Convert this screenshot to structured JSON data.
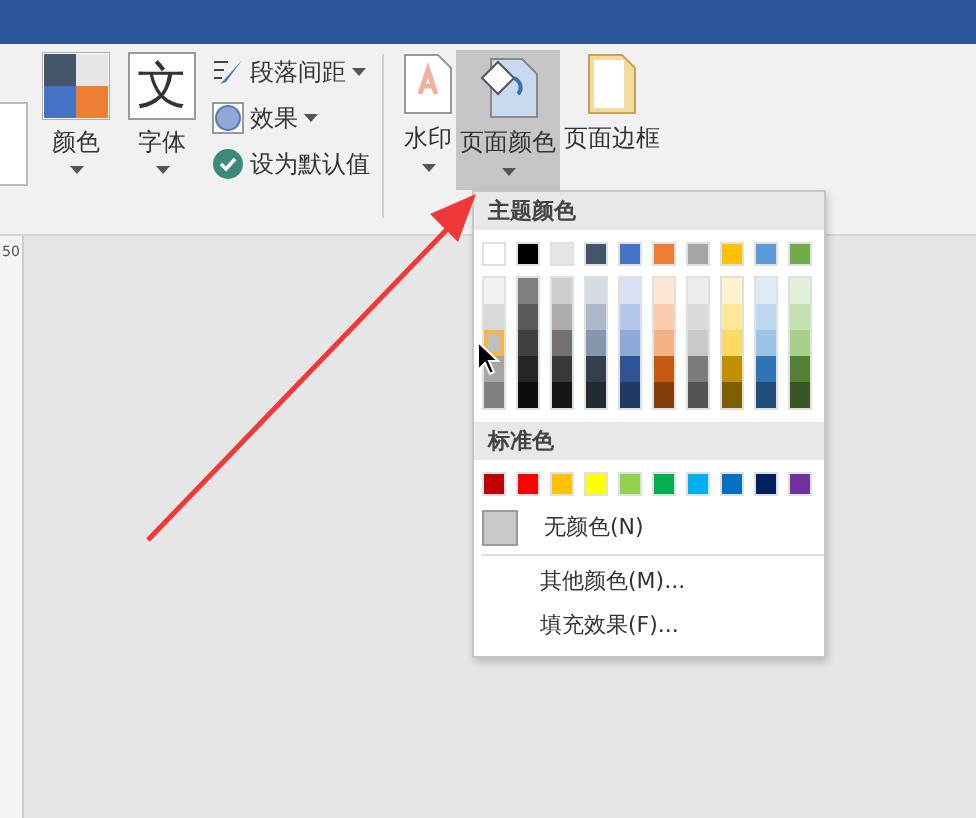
{
  "ribbon": {
    "large_left": [
      {
        "kind": "colors",
        "label": "颜色"
      },
      {
        "kind": "fonts",
        "glyph": "文",
        "label": "字体"
      }
    ],
    "small": [
      {
        "kind": "spacing",
        "label": "段落间距",
        "dropdown": true
      },
      {
        "kind": "effects",
        "label": "效果",
        "dropdown": true
      },
      {
        "kind": "default",
        "label": "设为默认值",
        "dropdown": false
      }
    ],
    "large_right": [
      {
        "kind": "watermark",
        "label": "水印",
        "dropdown": true,
        "selected": false
      },
      {
        "kind": "pagecolor",
        "label": "页面颜色",
        "dropdown": true,
        "selected": true
      },
      {
        "kind": "border",
        "label": "页面边框",
        "dropdown": false,
        "selected": false
      }
    ]
  },
  "ruler": {
    "mark": "50"
  },
  "color_menu": {
    "theme_heading": "主题颜色",
    "theme_colors": [
      {
        "color": "#ffffff",
        "selected": false,
        "shades": [
          {
            "color": "#f2f2f2",
            "selected": false
          },
          {
            "color": "#d9d9d9",
            "selected": false
          },
          {
            "color": "#bfbfbf",
            "selected": true
          },
          {
            "color": "#a6a6a6",
            "selected": false
          },
          {
            "color": "#808080",
            "selected": false
          }
        ]
      },
      {
        "color": "#000000",
        "selected": false,
        "shades": [
          {
            "color": "#7f7f7f",
            "selected": false
          },
          {
            "color": "#595959",
            "selected": false
          },
          {
            "color": "#404040",
            "selected": false
          },
          {
            "color": "#262626",
            "selected": false
          },
          {
            "color": "#0d0d0d",
            "selected": false
          }
        ]
      },
      {
        "color": "#e7e6e6",
        "selected": false,
        "shades": [
          {
            "color": "#d0cece",
            "selected": false
          },
          {
            "color": "#aeabab",
            "selected": false
          },
          {
            "color": "#757070",
            "selected": false
          },
          {
            "color": "#3a3838",
            "selected": false
          },
          {
            "color": "#171616",
            "selected": false
          }
        ]
      },
      {
        "color": "#44546a",
        "selected": false,
        "shades": [
          {
            "color": "#d6dce4",
            "selected": false
          },
          {
            "color": "#adb9ca",
            "selected": false
          },
          {
            "color": "#8496b0",
            "selected": false
          },
          {
            "color": "#333f4f",
            "selected": false
          },
          {
            "color": "#222a35",
            "selected": false
          }
        ]
      },
      {
        "color": "#4472c4",
        "selected": false,
        "shades": [
          {
            "color": "#d9e2f3",
            "selected": false
          },
          {
            "color": "#b4c6e7",
            "selected": false
          },
          {
            "color": "#8eaadb",
            "selected": false
          },
          {
            "color": "#2f5496",
            "selected": false
          },
          {
            "color": "#1f3864",
            "selected": false
          }
        ]
      },
      {
        "color": "#ed7d31",
        "selected": false,
        "shades": [
          {
            "color": "#fbe5d5",
            "selected": false
          },
          {
            "color": "#f7cbac",
            "selected": false
          },
          {
            "color": "#f4b183",
            "selected": false
          },
          {
            "color": "#c55a11",
            "selected": false
          },
          {
            "color": "#843c0b",
            "selected": false
          }
        ]
      },
      {
        "color": "#a5a5a5",
        "selected": false,
        "shades": [
          {
            "color": "#ededed",
            "selected": false
          },
          {
            "color": "#dbdbdb",
            "selected": false
          },
          {
            "color": "#c9c9c9",
            "selected": false
          },
          {
            "color": "#7b7b7b",
            "selected": false
          },
          {
            "color": "#525252",
            "selected": false
          }
        ]
      },
      {
        "color": "#ffc000",
        "selected": false,
        "shades": [
          {
            "color": "#fff2cc",
            "selected": false
          },
          {
            "color": "#ffe699",
            "selected": false
          },
          {
            "color": "#ffd966",
            "selected": false
          },
          {
            "color": "#bf9000",
            "selected": false
          },
          {
            "color": "#7f6000",
            "selected": false
          }
        ]
      },
      {
        "color": "#5b9bd5",
        "selected": false,
        "shades": [
          {
            "color": "#deebf6",
            "selected": false
          },
          {
            "color": "#bdd7ee",
            "selected": false
          },
          {
            "color": "#9dc3e6",
            "selected": false
          },
          {
            "color": "#2e75b5",
            "selected": false
          },
          {
            "color": "#1f4e79",
            "selected": false
          }
        ]
      },
      {
        "color": "#70ad47",
        "selected": false,
        "shades": [
          {
            "color": "#e2efd9",
            "selected": false
          },
          {
            "color": "#c5e0b3",
            "selected": false
          },
          {
            "color": "#a8d08d",
            "selected": false
          },
          {
            "color": "#538135",
            "selected": false
          },
          {
            "color": "#375623",
            "selected": false
          }
        ]
      }
    ],
    "standard_heading": "标准色",
    "standard_colors": [
      {
        "color": "#c00000",
        "selected": false
      },
      {
        "color": "#ff0000",
        "selected": false
      },
      {
        "color": "#ffc000",
        "selected": false
      },
      {
        "color": "#ffff00",
        "selected": false
      },
      {
        "color": "#92d050",
        "selected": false
      },
      {
        "color": "#00b050",
        "selected": false
      },
      {
        "color": "#00b0f0",
        "selected": false
      },
      {
        "color": "#0070c0",
        "selected": false
      },
      {
        "color": "#002060",
        "selected": false
      },
      {
        "color": "#7030a0",
        "selected": false
      }
    ],
    "no_color": "无颜色(N)",
    "items": [
      "其他颜色(M)...",
      "填充效果(F)..."
    ]
  }
}
